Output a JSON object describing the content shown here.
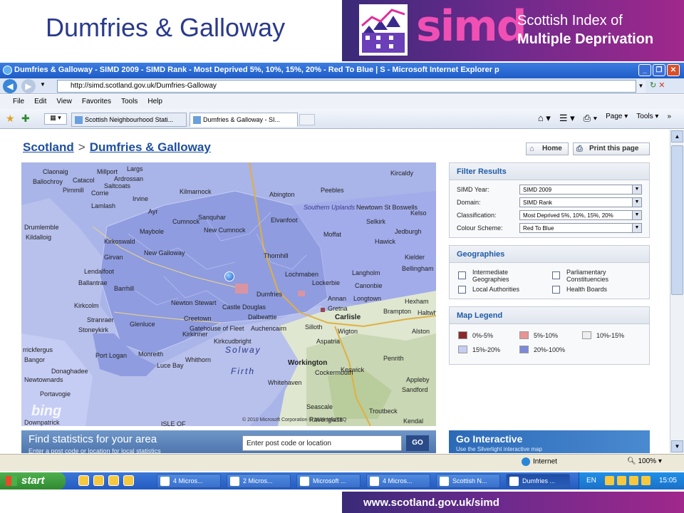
{
  "slide": {
    "title": "Dumfries & Galloway",
    "simd_word": "simd",
    "simd_sub1": "Scottish Index of",
    "simd_sub2": "Multiple Deprivation",
    "footer_url": "www.scotland.gov.uk/simd"
  },
  "browser": {
    "window_title": "Dumfries & Galloway - SIMD 2009 - SIMD Rank - Most Deprived 5%, 10%, 15%, 20% - Red To Blue | S - Microsoft Internet Explorer p",
    "address": "http://simd.scotland.gov.uk/Dumfries-Galloway",
    "menu": [
      "File",
      "Edit",
      "View",
      "Favorites",
      "Tools",
      "Help"
    ],
    "tabs": [
      "Scottish Neighbourhood Stati...",
      "Dumfries & Galloway - SI..."
    ],
    "commands": [
      "Page",
      "Tools"
    ]
  },
  "page": {
    "breadcrumb_root": "Scotland",
    "breadcrumb_sep": ">",
    "breadcrumb_current": "Dumfries & Galloway",
    "home_label": "Home",
    "print_label": "Print this page"
  },
  "map": {
    "labels": [
      {
        "text": "Claonaig"
      },
      {
        "text": "Millport"
      },
      {
        "text": "Largs"
      },
      {
        "text": "Ballochroy"
      },
      {
        "text": "Catacol"
      },
      {
        "text": "Pirnmill"
      },
      {
        "text": "Saltcoats"
      },
      {
        "text": "Irvine"
      },
      {
        "text": "Corrie"
      },
      {
        "text": "Kilmarnock"
      },
      {
        "text": "Lamlash"
      },
      {
        "text": "Drumlemble"
      },
      {
        "text": "Kildalloig"
      },
      {
        "text": "Ayr"
      },
      {
        "text": "Maybole"
      },
      {
        "text": "Kirkoswald"
      },
      {
        "text": "Girvan"
      },
      {
        "text": "Lendalfoot"
      },
      {
        "text": "Ballantrae"
      },
      {
        "text": "Barrhill"
      },
      {
        "text": "Kirkcolm"
      },
      {
        "text": "Stranraer"
      },
      {
        "text": "Stoneykirk"
      },
      {
        "text": "Glenluce"
      },
      {
        "text": "Port Logan"
      },
      {
        "text": "Monreith"
      },
      {
        "text": "Whithorn"
      },
      {
        "text": "Luce Bay"
      },
      {
        "text": "New Galloway"
      },
      {
        "text": "Newton Stewart"
      },
      {
        "text": "Creetown"
      },
      {
        "text": "Gatehouse of Fleet"
      },
      {
        "text": "Kirkinner"
      },
      {
        "text": "Castle Douglas"
      },
      {
        "text": "Dalbeattie"
      },
      {
        "text": "Kirkcudbright"
      },
      {
        "text": "Auchencairn"
      },
      {
        "text": "Dumfries"
      },
      {
        "text": "Lochmaben"
      },
      {
        "text": "Lockerbie"
      },
      {
        "text": "Annan"
      },
      {
        "text": "Moffat"
      },
      {
        "text": "Thornhill"
      },
      {
        "text": "Sanquhar"
      },
      {
        "text": "Cumnock"
      },
      {
        "text": "New Cumnock"
      },
      {
        "text": "Abington"
      },
      {
        "text": "Elvanfoot"
      },
      {
        "text": "Langholm"
      },
      {
        "text": "Canonbie"
      },
      {
        "text": "Gretna"
      },
      {
        "text": "Longtown"
      },
      {
        "text": "Carlisle"
      },
      {
        "text": "Brampton"
      },
      {
        "text": "Wigton"
      },
      {
        "text": "Aspatria"
      },
      {
        "text": "Silloth"
      },
      {
        "text": "Workington"
      },
      {
        "text": "Whitehaven"
      },
      {
        "text": "Cockermouth"
      },
      {
        "text": "Keswick"
      },
      {
        "text": "Penrith"
      },
      {
        "text": "Appleby"
      },
      {
        "text": "Kielder"
      },
      {
        "text": "Bellingham"
      },
      {
        "text": "Hexham"
      },
      {
        "text": "Haltwhistle"
      },
      {
        "text": "Alston"
      },
      {
        "text": "Hawick"
      },
      {
        "text": "Selkirk"
      },
      {
        "text": "Peebles"
      },
      {
        "text": "Jedburgh"
      },
      {
        "text": "Newtown St Boswells"
      },
      {
        "text": "Kelso"
      },
      {
        "text": "Southern Uplands"
      },
      {
        "text": "Kircaldy"
      },
      {
        "text": "Ardrossan"
      },
      {
        "text": "Donaghadee"
      },
      {
        "text": "Bangor"
      },
      {
        "text": "Newtownards"
      },
      {
        "text": "Portavogie"
      },
      {
        "text": "Downpatrick"
      },
      {
        "text": "rrickfergus"
      },
      {
        "text": "Sandford"
      },
      {
        "text": "Kendal"
      },
      {
        "text": "Seascale"
      },
      {
        "text": "Ravenglass"
      },
      {
        "text": "Troutbeck"
      }
    ],
    "sea_labels": [
      "Solway",
      "Firth"
    ],
    "bing_text": "bing",
    "copyright": "© 2010 Microsoft Corporation   © 2009 NAVTEQ",
    "isle_label": "ISLE OF"
  },
  "filter": {
    "title": "Filter Results",
    "rows": [
      {
        "label": "SIMD Year:",
        "value": "SIMD 2009"
      },
      {
        "label": "Domain:",
        "value": "SIMD Rank"
      },
      {
        "label": "Classification:",
        "value": "Most Deprived 5%, 10%, 15%, 20%"
      },
      {
        "label": "Colour Scheme:",
        "value": "Red To Blue"
      }
    ]
  },
  "geographies": {
    "title": "Geographies",
    "items": [
      "Intermediate Geographies",
      "Parliamentary Constituencies",
      "Local Authorities",
      "Health Boards"
    ]
  },
  "legend": {
    "title": "Map Legend",
    "items": [
      {
        "label": "0%-5%",
        "color": "#8b2a2a"
      },
      {
        "label": "5%-10%",
        "color": "#e89494"
      },
      {
        "label": "10%-15%",
        "color": "#eeeeee"
      },
      {
        "label": "15%-20%",
        "color": "#c6cdf4"
      },
      {
        "label": "20%-100%",
        "color": "#7d89d8"
      }
    ]
  },
  "find": {
    "title": "Find statistics for your area",
    "subtitle": "Enter a post code or location for local statistics",
    "placeholder": "Enter post code or location",
    "go": "GO"
  },
  "interactive": {
    "title": "Go Interactive",
    "subtitle": "Use the Silverlight interactive map"
  },
  "status": {
    "zone": "Internet",
    "zoom": "100%"
  },
  "taskbar": {
    "start": "start",
    "buttons": [
      "4 Micros...",
      "2 Micros...",
      "Microsoft ...",
      "4 Micros...",
      "Scottish N...",
      "Dumfries ..."
    ],
    "lang": "EN",
    "time": "15:05"
  }
}
